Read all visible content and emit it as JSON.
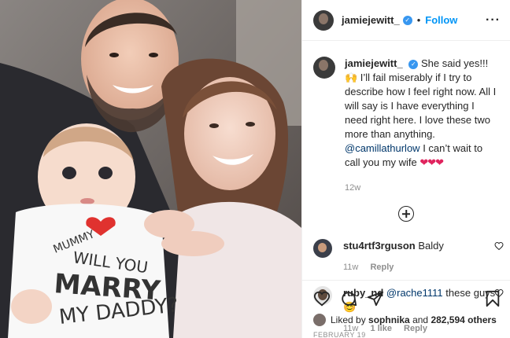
{
  "photo": {
    "onesie_lines": [
      "MUMMY",
      "WILL YOU",
      "MARRY",
      "MY DADDY?"
    ]
  },
  "post": {
    "username": "jamiejewitt_",
    "follow_label": "Follow",
    "separator": "•",
    "more_icon": "ellipsis-icon"
  },
  "caption": {
    "username": "jamiejewitt_",
    "text_1": "She said yes!!! 🙌 I’ll fail miserably if I try to describe how I feel right now. All I will say is I have everything I need right here. I love these two more than anything.",
    "mention": "@camillathurlow",
    "text_2": "I can’t wait to call you my wife",
    "hearts": "❤❤❤",
    "time": "12w"
  },
  "comments": [
    {
      "username": "stu4rtf3rguson",
      "text": "Baldy",
      "time": "11w",
      "likes": "",
      "reply": "Reply"
    },
    {
      "username": "ruby_nd",
      "mention": "@rache1111",
      "text": "these guys 😊",
      "time": "11w",
      "likes": "1 like",
      "reply": "Reply"
    }
  ],
  "footer": {
    "liked_by_prefix": "Liked by",
    "liked_by_user": "sophnika",
    "and": "and",
    "others_count": "282,594 others",
    "date": "FEBRUARY 19"
  }
}
